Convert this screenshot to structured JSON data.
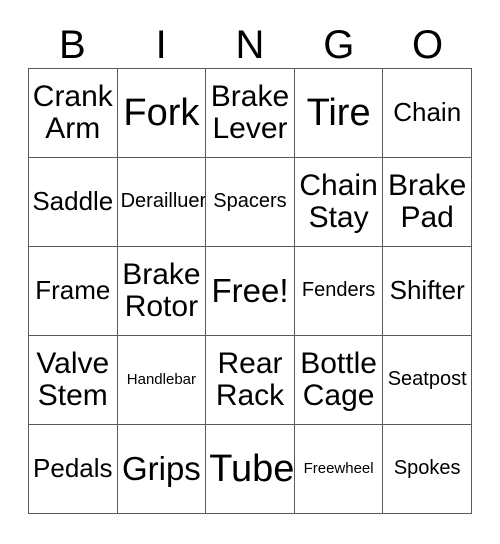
{
  "card": {
    "header_letters": [
      "B",
      "I",
      "N",
      "G",
      "O"
    ],
    "columns": 5,
    "rows": 5,
    "border_color": "#5a5a5a",
    "background_color": "#ffffff",
    "text_color": "#000000",
    "free_space_label": "Free!",
    "cells": [
      [
        {
          "label": "Crank Arm",
          "size": "md",
          "free": false
        },
        {
          "label": "Fork",
          "size": "xl",
          "free": false
        },
        {
          "label": "Brake Lever",
          "size": "md",
          "free": false
        },
        {
          "label": "Tire",
          "size": "xl",
          "free": false
        },
        {
          "label": "Chain",
          "size": "sm",
          "free": false
        }
      ],
      [
        {
          "label": "Saddle",
          "size": "sm",
          "free": false
        },
        {
          "label": "Derailluer",
          "size": "xs",
          "free": false
        },
        {
          "label": "Spacers",
          "size": "xs",
          "free": false
        },
        {
          "label": "Chain Stay",
          "size": "md",
          "free": false
        },
        {
          "label": "Brake Pad",
          "size": "md",
          "free": false
        }
      ],
      [
        {
          "label": "Frame",
          "size": "sm",
          "free": false
        },
        {
          "label": "Brake Rotor",
          "size": "md",
          "free": false
        },
        {
          "label": "Free!",
          "size": "lg",
          "free": true
        },
        {
          "label": "Fenders",
          "size": "xs",
          "free": false
        },
        {
          "label": "Shifter",
          "size": "sm",
          "free": false
        }
      ],
      [
        {
          "label": "Valve Stem",
          "size": "md",
          "free": false
        },
        {
          "label": "Handlebar",
          "size": "xxs",
          "free": false
        },
        {
          "label": "Rear Rack",
          "size": "md",
          "free": false
        },
        {
          "label": "Bottle Cage",
          "size": "md",
          "free": false
        },
        {
          "label": "Seatpost",
          "size": "xs",
          "free": false
        }
      ],
      [
        {
          "label": "Pedals",
          "size": "sm",
          "free": false
        },
        {
          "label": "Grips",
          "size": "lg",
          "free": false
        },
        {
          "label": "Tube",
          "size": "xl",
          "free": false
        },
        {
          "label": "Freewheel",
          "size": "xxs",
          "free": false
        },
        {
          "label": "Spokes",
          "size": "xs",
          "free": false
        }
      ]
    ]
  }
}
